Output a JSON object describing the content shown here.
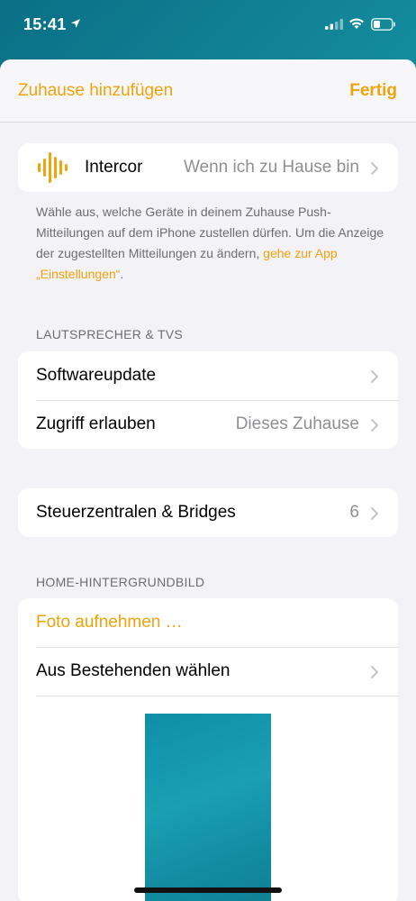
{
  "status_bar": {
    "time": "15:41",
    "icons": [
      "location-arrow-icon",
      "cellular-signal-icon",
      "wifi-icon",
      "battery-icon"
    ]
  },
  "nav": {
    "left_label": "Zuhause hinzufügen",
    "right_label": "Fertig"
  },
  "intercor": {
    "icon": "soundwave-icon",
    "label": "Intercor",
    "value": "Wenn ich zu Hause bin"
  },
  "footnote": {
    "text": "Wähle aus, welche Geräte in deinem Zuhause Push-Mitteilungen auf dem iPhone zustellen dürfen. Um die Anzeige der zugestellten Mitteilungen zu ändern, ",
    "link": "gehe zur App „Einstellungen“",
    "suffix": "."
  },
  "speakers_section": {
    "header": "LAUTSPRECHER & TVS",
    "rows": [
      {
        "label": "Softwareupdate",
        "value": ""
      },
      {
        "label": "Zugriff erlauben",
        "value": "Dieses Zuhause"
      }
    ]
  },
  "hubs": {
    "label": "Steuerzentralen & Bridges",
    "value": "6"
  },
  "wallpaper_section": {
    "header": "HOME-HINTERGRUNDBILD",
    "take_photo": "Foto aufnehmen …",
    "choose_existing": "Aus Bestehenden wählen"
  },
  "colors": {
    "accent": "#f0a30a",
    "background": "#f2f2f7",
    "secondary_text": "#8e8e93"
  }
}
